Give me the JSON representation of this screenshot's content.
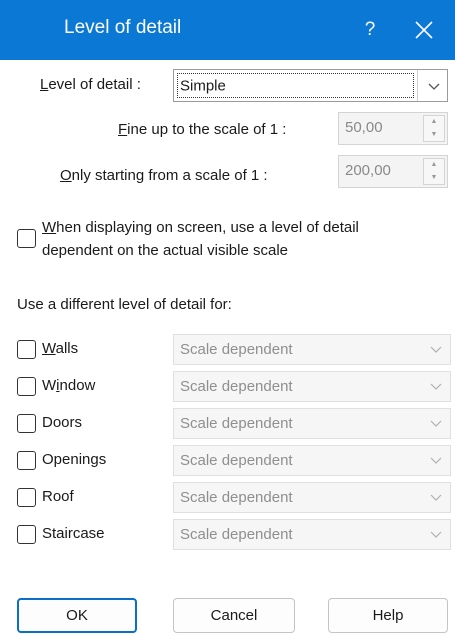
{
  "titlebar": {
    "title": "Level of detail",
    "help_label": "?",
    "close_icon": "close-icon"
  },
  "level": {
    "label_ul": "L",
    "label_rest": "evel of detail :",
    "value": "Simple"
  },
  "fine": {
    "label_ul": "F",
    "label_rest": "ine up to the scale of 1 :",
    "value": "50,00"
  },
  "starting": {
    "label_ul": "O",
    "label_rest": "nly starting from a scale of 1  :",
    "value": "200,00"
  },
  "screen_option": {
    "label_ul": "W",
    "line1_rest": "hen displaying on screen, use a level of detail",
    "line2": "dependent on the actual visible scale",
    "checked": false
  },
  "different_label": "Use a different level of detail for:",
  "rows": [
    {
      "label_pre": "",
      "label_ul": "W",
      "label_post": "alls",
      "value": "Scale dependent",
      "checked": false
    },
    {
      "label_pre": "W",
      "label_ul": "i",
      "label_post": "ndow",
      "value": "Scale dependent",
      "checked": false
    },
    {
      "label_pre": "",
      "label_ul": "",
      "label_post": "Doors",
      "value": "Scale dependent",
      "checked": false
    },
    {
      "label_pre": "",
      "label_ul": "",
      "label_post": "Openings",
      "value": "Scale dependent",
      "checked": false
    },
    {
      "label_pre": "",
      "label_ul": "",
      "label_post": "Roof",
      "value": "Scale dependent",
      "checked": false
    },
    {
      "label_pre": "",
      "label_ul": "",
      "label_post": "Staircase",
      "value": "Scale dependent",
      "checked": false
    }
  ],
  "buttons": {
    "ok": "OK",
    "cancel": "Cancel",
    "help": "Help"
  },
  "colors": {
    "titlebar": "#0a78d4",
    "default_button_border": "#0a6fc7"
  }
}
